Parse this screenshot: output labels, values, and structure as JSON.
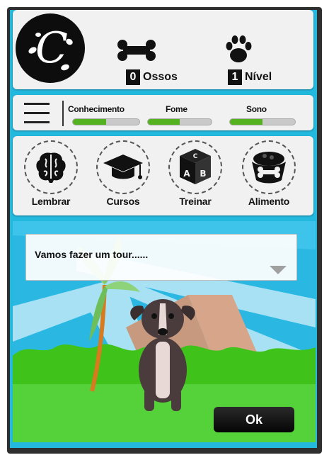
{
  "header": {
    "logo_letter": "C",
    "bones": {
      "count": "0",
      "label": "Ossos",
      "icon": "bone-icon"
    },
    "level": {
      "count": "1",
      "label": "Nível",
      "icon": "paw-icon"
    }
  },
  "stats": {
    "menu_icon": "hamburger-menu-icon",
    "items": [
      {
        "label": "Conhecimento",
        "fill": 0.5
      },
      {
        "label": "Fome",
        "fill": 0.5
      },
      {
        "label": "Sono",
        "fill": 0.5
      }
    ],
    "bar_color": "#54b11f"
  },
  "actions": [
    {
      "label": "Lembrar",
      "icon": "brain-icon"
    },
    {
      "label": "Cursos",
      "icon": "graduation-cap-icon"
    },
    {
      "label": "Treinar",
      "icon": "abc-cube-icon"
    },
    {
      "label": "Alimento",
      "icon": "dog-bowl-icon"
    }
  ],
  "tour": {
    "message": "Vamos fazer um tour......",
    "ok_label": "Ok"
  },
  "colors": {
    "background": "#23b9df",
    "panel": "#f1f1f1",
    "grass": "#3fc21a"
  }
}
